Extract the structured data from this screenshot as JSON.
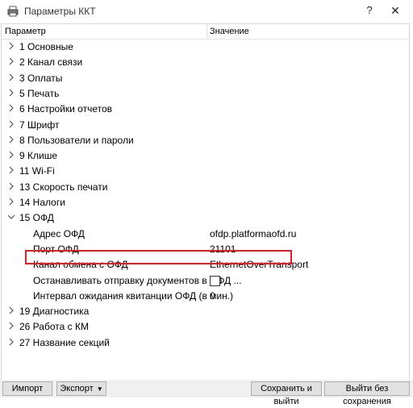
{
  "window": {
    "title": "Параметры ККТ",
    "help_label": "?",
    "close_label": "✕"
  },
  "tree": {
    "col_param": "Параметр",
    "col_value": "Значение",
    "items": [
      {
        "label": "1 Основные",
        "expanded": false
      },
      {
        "label": "2 Канал связи",
        "expanded": false
      },
      {
        "label": "3 Оплаты",
        "expanded": false
      },
      {
        "label": "5 Печать",
        "expanded": false
      },
      {
        "label": "6 Настройки отчетов",
        "expanded": false
      },
      {
        "label": "7 Шрифт",
        "expanded": false
      },
      {
        "label": "8 Пользователи и пароли",
        "expanded": false
      },
      {
        "label": "9 Клише",
        "expanded": false
      },
      {
        "label": "11 Wi-Fi",
        "expanded": false
      },
      {
        "label": "13 Скорость печати",
        "expanded": false
      },
      {
        "label": "14 Налоги",
        "expanded": false
      },
      {
        "label": "15 ОФД",
        "expanded": true
      },
      {
        "label": "19 Диагностика",
        "expanded": false
      },
      {
        "label": "26 Работа с КМ",
        "expanded": false
      },
      {
        "label": "27 Название секций",
        "expanded": false
      }
    ],
    "ofd_children": [
      {
        "label": "Адрес ОФД",
        "value": "ofdp.platformaofd.ru"
      },
      {
        "label": "Порт ОФД",
        "value": "21101"
      },
      {
        "label": "Канал обмена с ОФД",
        "value": "EthernetOverTransport"
      },
      {
        "label": "Останавливать отправку документов в ОФД ...",
        "value": "",
        "checked": false
      },
      {
        "label": "Интервал ожидания квитанции ОФД (в мин.)",
        "value": "0"
      }
    ]
  },
  "buttons": {
    "import": "Импорт",
    "export": "Экспорт",
    "save_exit": "Сохранить и выйти",
    "exit_no_save": "Выйти без сохранения"
  },
  "colors": {
    "highlight": "#e01e24"
  }
}
